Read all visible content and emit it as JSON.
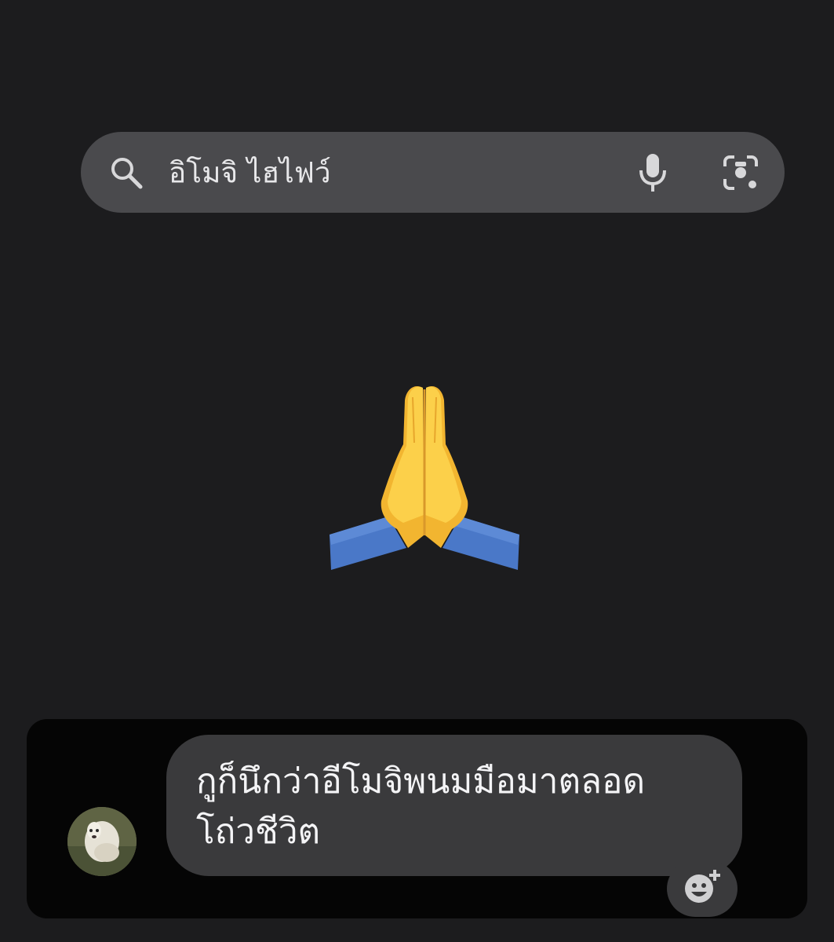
{
  "search": {
    "query": "อิโมจิ ไฮไฟว์",
    "search_icon": "search-icon",
    "mic_icon": "microphone-icon",
    "lens_icon": "camera-lens-icon"
  },
  "result": {
    "emoji": "🙏",
    "emoji_icon": "folded-hands-icon"
  },
  "comment": {
    "text": "กูก็นึกว่าอีโมจิพนมมือมาตลอด\nโถ่วชีวิต",
    "avatar": "avatar",
    "reaction_icon": "add-reaction-icon"
  },
  "colors": {
    "background": "#1c1c1e",
    "search_bar": "#4a4a4d",
    "panel": "#050505",
    "bubble": "#3a3a3c",
    "text": "#f4f4f6"
  }
}
